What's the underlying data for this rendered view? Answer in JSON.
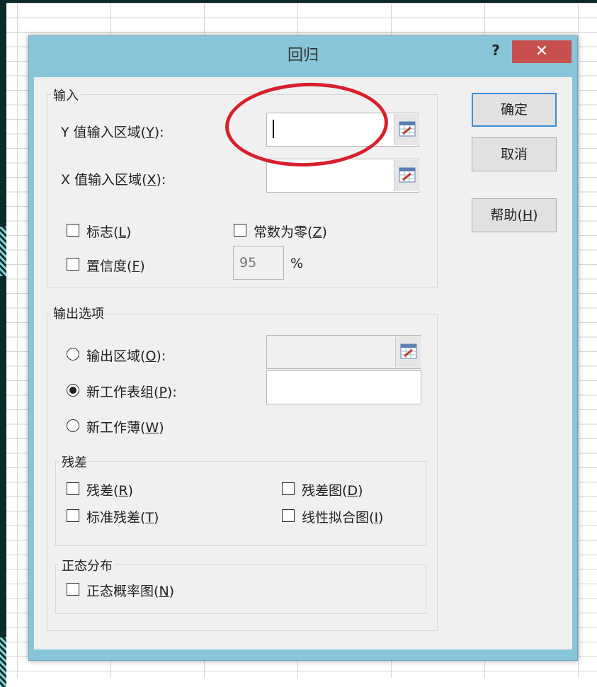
{
  "dialog": {
    "title": "回归",
    "help_glyph": "?",
    "close_glyph": "✕"
  },
  "buttons": {
    "ok": "确定",
    "cancel": "取消",
    "help": "帮助"
  },
  "input_group": {
    "label": "输入",
    "y_range_label": "Y 值输入区域",
    "y_range_value": "",
    "x_range_label": "X 值输入区域",
    "x_range_value": "",
    "labels_checkbox": "标志",
    "constant_zero_checkbox": "常数为零",
    "confidence_checkbox": "置信度",
    "confidence_value": "95",
    "percent": "%"
  },
  "output_group": {
    "label": "输出选项",
    "output_range_radio": "输出区域",
    "output_range_value": "",
    "new_worksheet_radio": "新工作表组",
    "new_worksheet_value": "",
    "new_workbook_radio": "新工作薄",
    "selected": "new_worksheet"
  },
  "residuals_group": {
    "label": "残差",
    "residuals": "残差",
    "residual_plots": "残差图",
    "standardized_residuals": "标准残差",
    "line_fit_plots": "线性拟合图"
  },
  "normal_group": {
    "label": "正态分布",
    "normal_probability_plots": "正态概率图"
  },
  "icons": {
    "range_picker": "collapse-dialog-icon"
  },
  "colors": {
    "titlebar": "#89c5d8",
    "close": "#c7504e",
    "annotation": "#d8202a",
    "default_button_border": "#3c8ed8"
  }
}
